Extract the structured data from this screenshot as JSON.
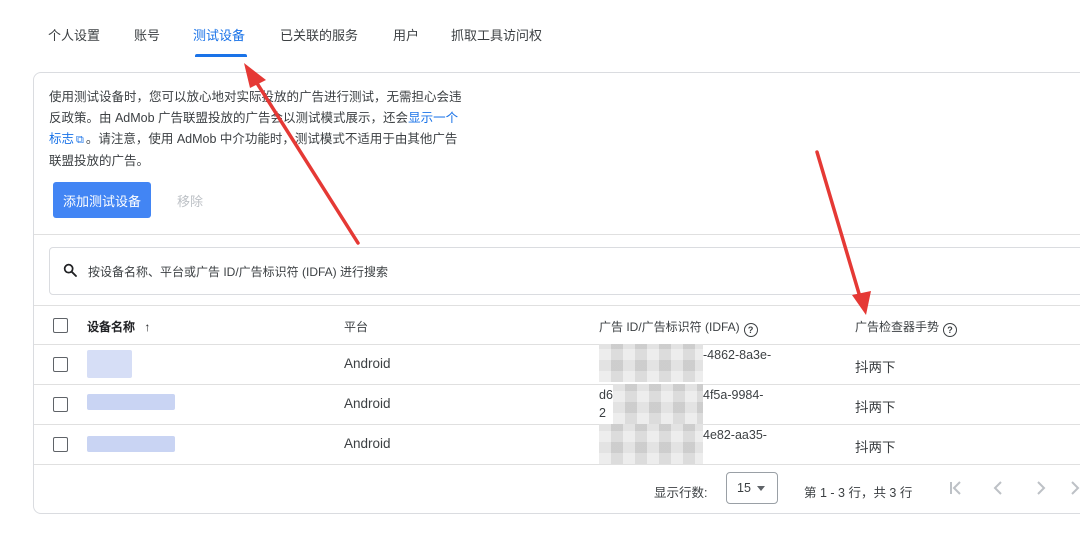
{
  "tabs": [
    {
      "label": "个人设置"
    },
    {
      "label": "账号"
    },
    {
      "label": "测试设备"
    },
    {
      "label": "已关联的服务"
    },
    {
      "label": "用户"
    },
    {
      "label": "抓取工具访问权"
    }
  ],
  "description": {
    "line1": "使用测试设备时，您可以放心地对实际投放的广告进行测试，无需担心会违",
    "line2_start": "反政策。由 AdMob 广告联盟投放的广告会以测试模式展示，还会",
    "link_part1": "显示一个",
    "link_part2": "标志",
    "line3_rest": "。请注意，使用 AdMob 中介功能时，测试模式不适用于由其他广告",
    "line4": "联盟投放的广告。"
  },
  "buttons": {
    "add": "添加测试设备",
    "remove": "移除"
  },
  "search": {
    "placeholder": "按设备名称、平台或广告 ID/广告标识符 (IDFA) 进行搜索"
  },
  "table": {
    "headers": {
      "name": "设备名称",
      "sort_arrow": "↑",
      "platform": "平台",
      "idfa": "广告 ID/广告标识符 (IDFA)",
      "gesture": "广告检查器手势"
    },
    "rows": [
      {
        "platform": "Android",
        "id_line1": "-4862-8a3e-",
        "id_line2": "",
        "gesture": "抖两下"
      },
      {
        "platform": "Android",
        "id_line1_prefix": "d6",
        "id_line1": "4f5a-9984-",
        "id_line2": "2",
        "gesture": "抖两下"
      },
      {
        "platform": "Android",
        "id_line1": "4e82-aa35-",
        "id_line2": "",
        "gesture": "抖两下"
      }
    ]
  },
  "pagination": {
    "rows_label": "显示行数:",
    "rows_value": "15",
    "range_text": "第 1 - 3 行，共 3 行"
  },
  "colors": {
    "accent": "#1a73e8",
    "button": "#4285f4",
    "annotation_arrow": "#e53935"
  }
}
